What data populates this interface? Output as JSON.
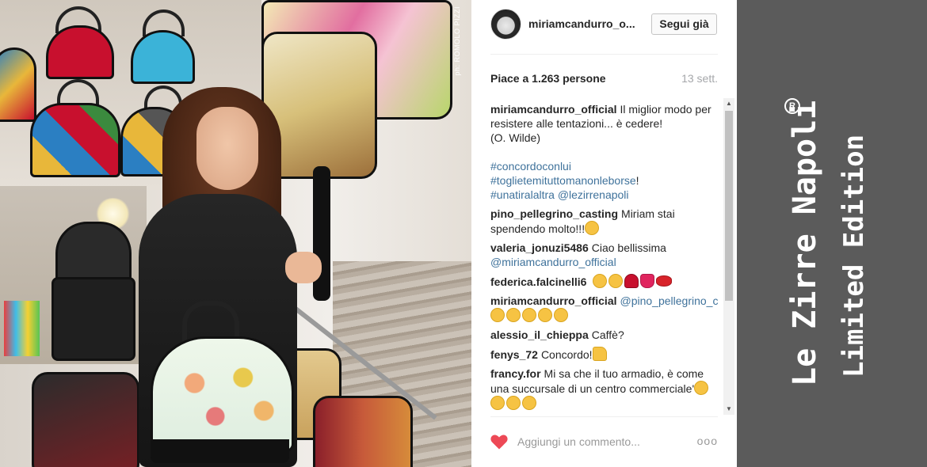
{
  "photo": {
    "watermark": "ph: ROMOLO PIZZI"
  },
  "post": {
    "username": "miriamcandurro_o...",
    "follow_label": "Segui già",
    "likes": "Piace a 1.263 persone",
    "age": "13 sett.",
    "caption": {
      "user": "miriamcandurro_official",
      "text": "Il miglior modo per resistere alle tentazioni... è cedere!",
      "attribution": "(O. Wilde)",
      "hashtag1": "#concordoconlui",
      "hashtag2": "#toglietemituttomanonleborse",
      "hashtag2_suffix": "!",
      "hashtag3": "#unatiralaltra",
      "mention": "@lezirrenapoli"
    },
    "comments": [
      {
        "user": "pino_pellegrino_casting",
        "text": "Miriam stai spendendo molto!!!"
      },
      {
        "user": "valeria_jonuzi5486",
        "text": "Ciao bellissima",
        "mention": "@miriamcandurro_official"
      },
      {
        "user": "federica.falcinelli6",
        "text": ""
      },
      {
        "user": "miriamcandurro_official",
        "mention": "@pino_pellegrino_casting",
        "text": ""
      },
      {
        "user": "alessio_il_chieppa",
        "text": "Caffè?"
      },
      {
        "user": "fenys_72",
        "text": "Concordo!"
      },
      {
        "user": "francy.for",
        "text": "Mi sa che il tuo armadio, è come una succursale di un centro commerciale'"
      }
    ],
    "add_comment_placeholder": "Aggiungi un commento...",
    "more_label": "ooo",
    "scroll_up": "▲",
    "scroll_down": "▼"
  },
  "brand": {
    "line1": "Le Zirre Napoli",
    "line2": "Limited Edition",
    "registered": "R"
  },
  "colors": {
    "link": "#3f729b",
    "heart": "#ed4956",
    "brand_bg": "#5b5b5b"
  }
}
